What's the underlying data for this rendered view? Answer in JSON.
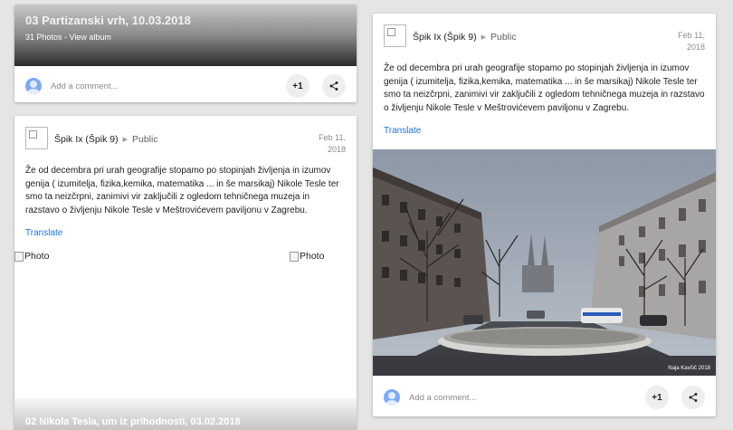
{
  "album_card": {
    "title": "03 Partizanski vrh, 10.03.2018",
    "subtitle": "31 Photos - View album",
    "comment_placeholder": "Add a comment...",
    "plus_one_label": "+1",
    "share_icon": "share-icon"
  },
  "left_post": {
    "author": "Špik Ix (Špik 9)",
    "visibility": "Public",
    "date_line1": "Feb 11,",
    "date_line2": "2018",
    "text": "Že od decembra pri urah geografije stopamo po stopinjah življenja in izumov genija ( izumitelja, fizika,kemika, matematika ... in še marsikaj) Nikole Tesle ter smo ta neizčrpni, zanimivi vir zaključili z ogledom tehničnega muzeja in razstavo o življenju Nikole Tesle v Meštrovićevem paviljonu v Zagrebu.",
    "translate": "Translate",
    "photo_alt_1": "Photo",
    "photo_alt_2": "Photo",
    "next_album_title": "02 Nikola Tesla, um iz prihodnosti, 03.02.2018"
  },
  "right_post": {
    "author": "Špik Ix (Špik 9)",
    "visibility": "Public",
    "date_line1": "Feb 11,",
    "date_line2": "2018",
    "text": "Že od decembra pri urah geografije stopamo po stopinjah življenja in izumov genija ( izumitelja, fizika,kemika, matematika ... in še marsikaj) Nikole Tesle ter smo ta neizčrpni, zanimivi vir zaključili z ogledom tehničnega muzeja in razstavo o življenju Nikole Tesle v Meštrovićevem paviljonu v Zagrebu.",
    "translate": "Translate",
    "photo_credit": "Naja Kavčič 2018",
    "comment_placeholder": "Add a comment...",
    "plus_one_label": "+1"
  },
  "colors": {
    "link": "#1a73e8",
    "avatar_blue": "#7baaf7",
    "page_bg": "#e5e5e5"
  }
}
